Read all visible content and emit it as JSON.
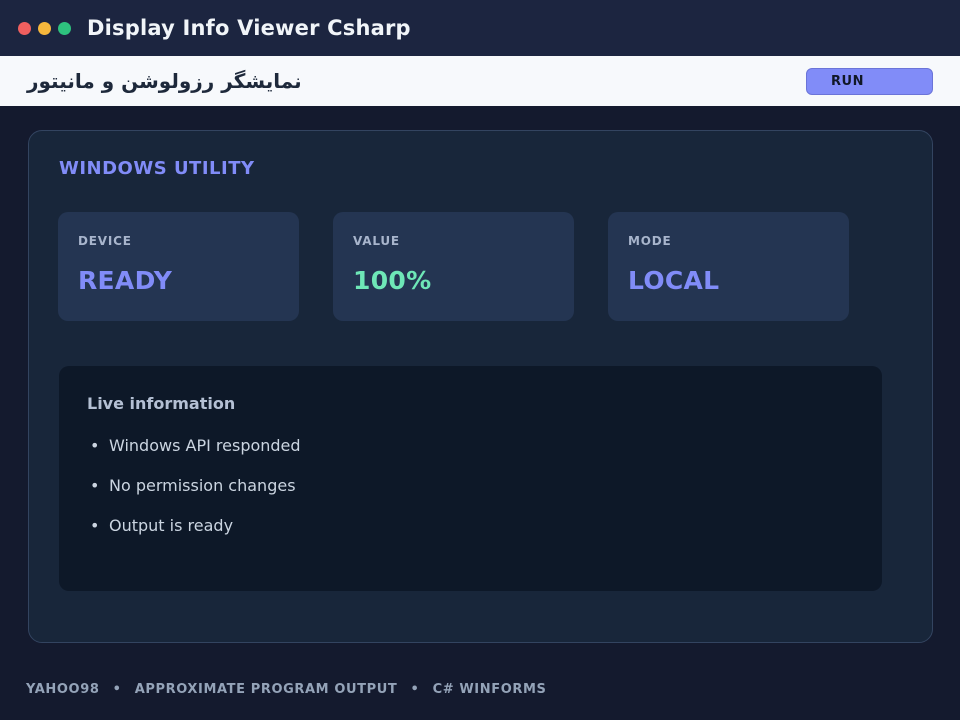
{
  "window": {
    "title": "Display Info Viewer Csharp",
    "traffic_lights": [
      {
        "name": "close",
        "color": "#ef5f5f"
      },
      {
        "name": "minimize",
        "color": "#f6b73c"
      },
      {
        "name": "maximize",
        "color": "#2ec27e"
      }
    ]
  },
  "toolbar": {
    "subtitle": "نمایشگر رزولوشن و مانیتور",
    "run_label": "RUN"
  },
  "panel": {
    "section_title": "WINDOWS UTILITY",
    "cards": [
      {
        "label": "DEVICE",
        "value": "READY",
        "color": "#818cf8"
      },
      {
        "label": "VALUE",
        "value": "100%",
        "color": "#6ee7b7"
      },
      {
        "label": "MODE",
        "value": "LOCAL",
        "color": "#818cf8"
      }
    ],
    "info": {
      "heading": "Live information",
      "bullet": "•",
      "items": [
        "Windows API responded",
        "No permission changes",
        "Output is ready"
      ]
    }
  },
  "footer": {
    "items": [
      "YAHOO98",
      "APPROXIMATE PROGRAM OUTPUT",
      "C# WINFORMS"
    ],
    "separator": "•"
  },
  "colors": {
    "background": "#141a2e",
    "titlebar": "#1c2540",
    "accent": "#818cf8",
    "success": "#6ee7b7"
  }
}
